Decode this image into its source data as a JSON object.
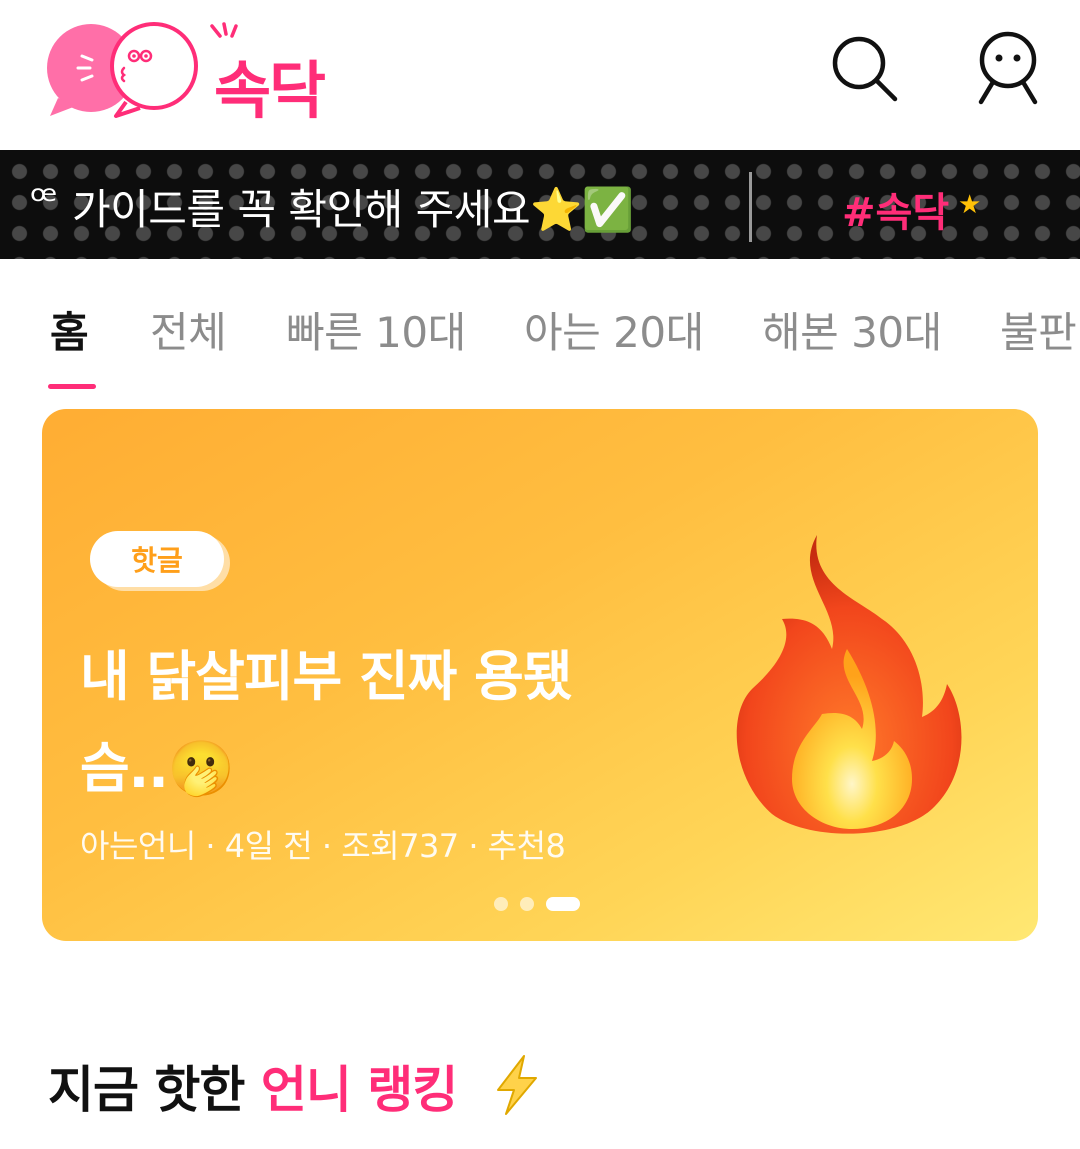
{
  "app": {
    "logo_text": "속닥",
    "colors": {
      "brand": "#ff2d78",
      "ticker_bg": "#0d0d0d",
      "banner_orange": "#ffad33",
      "banner_yellow": "#ffe873"
    }
  },
  "header": {
    "icons": [
      "search-icon",
      "profile-icon"
    ]
  },
  "ticker": {
    "cut_char": "ꟹ",
    "text": "가이드를 꼭 확인해 주세요⭐✅",
    "tag": "#속닥"
  },
  "tabs": [
    {
      "label": "홈",
      "active": true
    },
    {
      "label": "전체"
    },
    {
      "label": "빠른 10대"
    },
    {
      "label": "아는 20대"
    },
    {
      "label": "해본 30대"
    },
    {
      "label": "불판"
    }
  ],
  "banner": {
    "badge": "핫글",
    "title_line1": "내 닭살피부 진짜 용됐",
    "title_line2": "슴..🫢",
    "meta": "아는언니 · 4일 전 · 조회737 · 추천8",
    "pagination": {
      "total": 3,
      "current": 3
    }
  },
  "ranking": {
    "title_prefix": "지금 핫한 ",
    "title_accent": "언니 랭킹"
  }
}
